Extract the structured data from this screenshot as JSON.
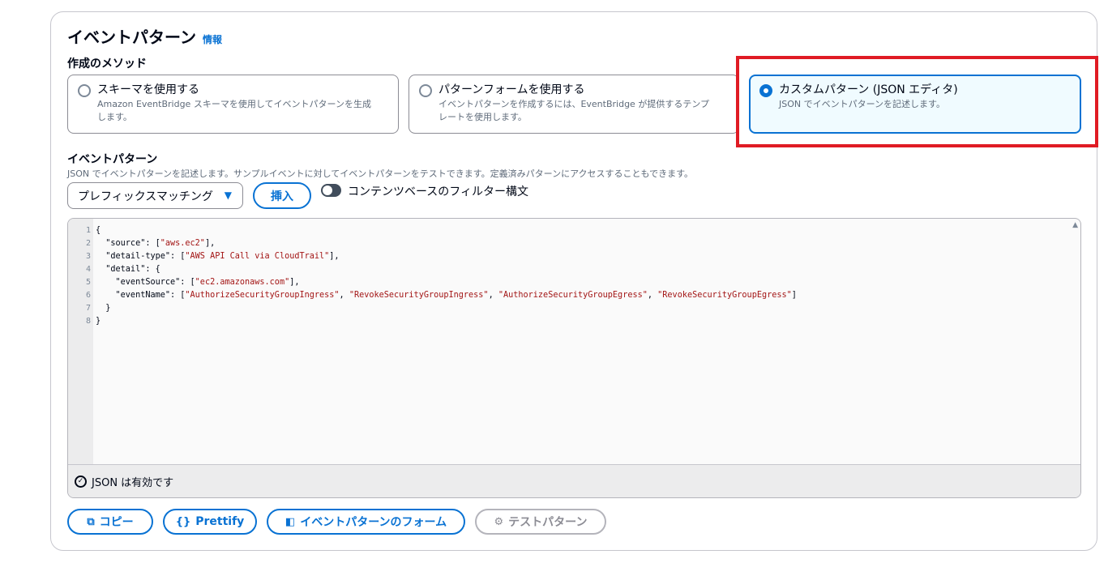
{
  "header": {
    "title": "イベントパターン",
    "info_link": "情報"
  },
  "method": {
    "label": "作成のメソッド",
    "options": [
      {
        "title": "スキーマを使用する",
        "desc_line1": "Amazon EventBridge スキーマを使用してイベントパターンを生成",
        "desc_line2": "します。",
        "selected": false
      },
      {
        "title": "パターンフォームを使用する",
        "desc_line1": "イベントパターンを作成するには、EventBridge が提供するテンプ",
        "desc_line2": "レートを使用します。",
        "selected": false
      },
      {
        "title": "カスタムパターン (JSON エディタ)",
        "desc_line1": "JSON でイベントパターンを記述します。",
        "desc_line2": "",
        "selected": true
      }
    ]
  },
  "pattern": {
    "label": "イベントパターン",
    "description": "JSON でイベントパターンを記述します。サンプルイベントに対してイベントパターンをテストできます。定義済みパターンにアクセスすることもできます。",
    "dropdown_value": "プレフィックスマッチング",
    "insert_button": "挿入",
    "toggle_label": "コンテンツベースのフィルター構文"
  },
  "editor": {
    "line_numbers": [
      "1",
      "2",
      "3",
      "4",
      "5",
      "6",
      "7",
      "8"
    ],
    "lines": [
      "{",
      "  \"source\": [\"aws.ec2\"],",
      "  \"detail-type\": [\"AWS API Call via CloudTrail\"],",
      "  \"detail\": {",
      "    \"eventSource\": [\"ec2.amazonaws.com\"],",
      "    \"eventName\": [\"AuthorizeSecurityGroupIngress\", \"RevokeSecurityGroupIngress\", \"AuthorizeSecurityGroupEgress\", \"RevokeSecurityGroupEgress\"]",
      "  }",
      "}"
    ],
    "status": "JSON は有効です"
  },
  "actions": {
    "copy": "コピー",
    "prettify": "Prettify",
    "form": "イベントパターンのフォーム",
    "test": "テストパターン"
  },
  "colors": {
    "accent": "#0972d3",
    "highlight": "#e01b24"
  }
}
